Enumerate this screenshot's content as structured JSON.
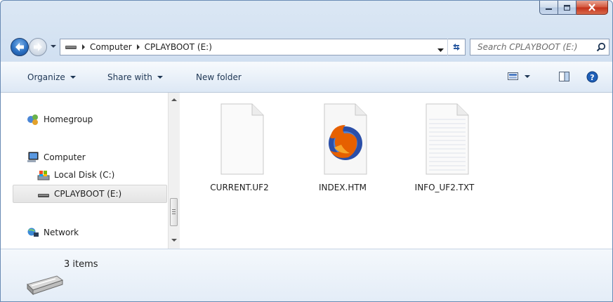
{
  "window": {
    "caption": {
      "minimize": "minimize",
      "maximize": "maximize",
      "close": "close"
    }
  },
  "address_bar": {
    "segments": [
      "Computer",
      "CPLAYBOOT (E:)"
    ]
  },
  "search": {
    "placeholder": "Search CPLAYBOOT (E:)"
  },
  "toolbar": {
    "organize_label": "Organize",
    "share_label": "Share with",
    "new_folder_label": "New folder"
  },
  "nav_pane": {
    "items": [
      {
        "label": "Homegroup",
        "icon": "homegroup-icon"
      },
      {
        "label": "Computer",
        "icon": "computer-icon"
      },
      {
        "label": "Local Disk (C:)",
        "icon": "local-disk-icon"
      },
      {
        "label": "CPLAYBOOT (E:)",
        "icon": "removable-drive-icon",
        "selected": true
      },
      {
        "label": "Network",
        "icon": "network-icon"
      }
    ]
  },
  "files": [
    {
      "name": "CURRENT.UF2",
      "icon": "blank-file-icon"
    },
    {
      "name": "INDEX.HTM",
      "icon": "firefox-document-icon"
    },
    {
      "name": "INFO_UF2.TXT",
      "icon": "text-file-icon"
    }
  ],
  "details": {
    "count_label": "3 items"
  },
  "colors": {
    "accent": "#2a6fc1",
    "close_button": "#c2301a",
    "firefox_orange": "#e66000"
  }
}
